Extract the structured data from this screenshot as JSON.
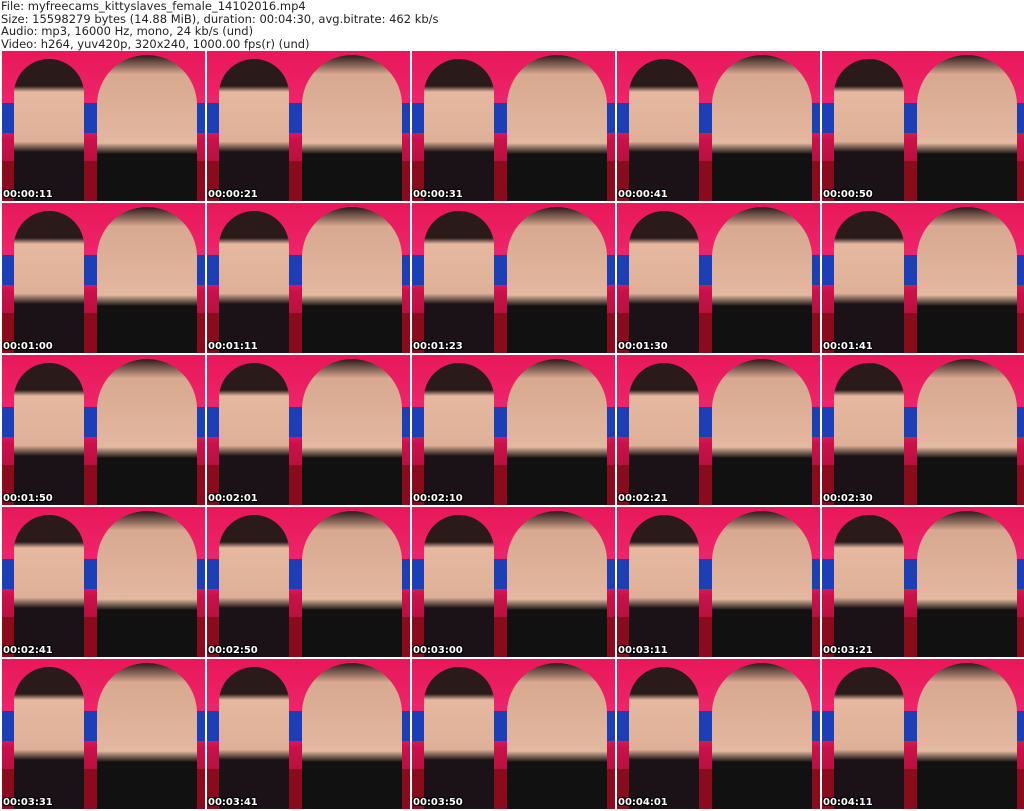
{
  "header": {
    "file": "File: myfreecams_kittyslaves_female_14102016.mp4",
    "size": "Size: 15598279 bytes (14.88 MiB), duration: 00:04:30, avg.bitrate: 462 kb/s",
    "audio": "Audio: mp3, 16000 Hz, mono, 24 kb/s (und)",
    "video": "Video: h264, yuv420p, 320x240, 1000.00 fps(r) (und)"
  },
  "timestamps": [
    "00:00:11",
    "00:00:21",
    "00:00:31",
    "00:00:41",
    "00:00:50",
    "00:01:00",
    "00:01:11",
    "00:01:23",
    "00:01:30",
    "00:01:41",
    "00:01:50",
    "00:02:01",
    "00:02:10",
    "00:02:21",
    "00:02:30",
    "00:02:41",
    "00:02:50",
    "00:03:00",
    "00:03:11",
    "00:03:21",
    "00:03:31",
    "00:03:41",
    "00:03:50",
    "00:04:01",
    "00:04:11"
  ]
}
